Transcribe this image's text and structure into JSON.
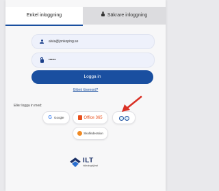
{
  "tabs": {
    "simple_login": "Enkel inloggning",
    "secure_login": "Säkrare inloggning"
  },
  "login_form": {
    "username_value": "alvia@jonkoping.se",
    "password_value": "••••••",
    "login_button": "Logga in",
    "forgot_password": "Glömt lösenord?"
  },
  "social_login": {
    "label": "Eller logga in med:",
    "google": "Google",
    "office365": "Office 365",
    "skolfederation": "Skolfederation"
  },
  "logo": {
    "name": "ILT",
    "subtitle": "Inläsningstjänst"
  },
  "colors": {
    "primary": "#1a4fa0",
    "arrow": "#d93025",
    "office": "#e8501d"
  }
}
